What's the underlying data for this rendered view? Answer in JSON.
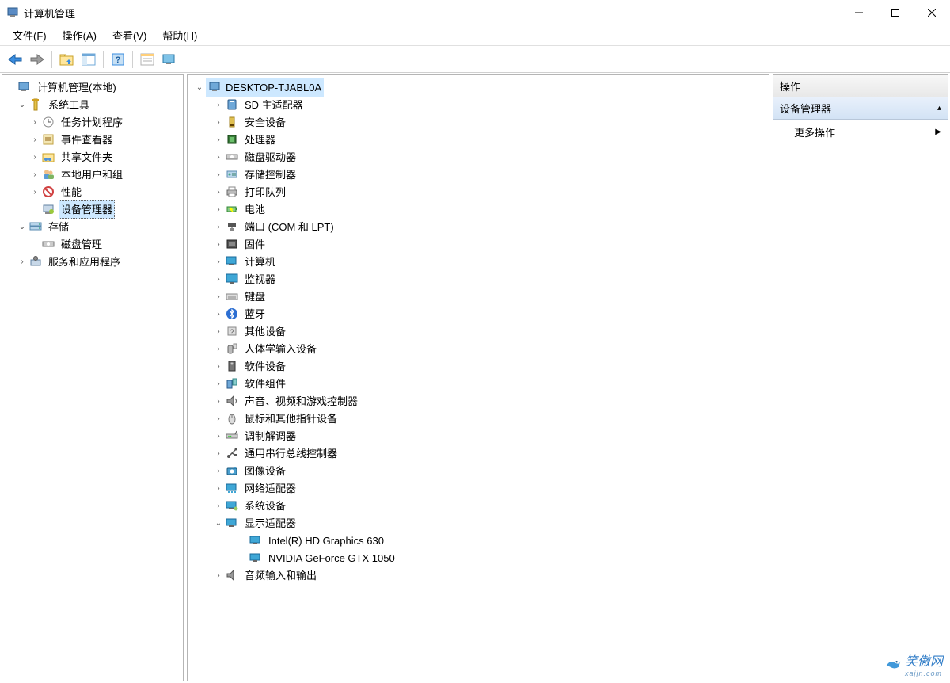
{
  "window": {
    "title": "计算机管理"
  },
  "menu": {
    "file": "文件(F)",
    "action": "操作(A)",
    "view": "查看(V)",
    "help": "帮助(H)"
  },
  "left_tree": {
    "root": "计算机管理(本地)",
    "sys_tools": "系统工具",
    "task_sched": "任务计划程序",
    "event_viewer": "事件查看器",
    "shared_folders": "共享文件夹",
    "local_users": "本地用户和组",
    "performance": "性能",
    "device_mgr": "设备管理器",
    "storage": "存储",
    "disk_mgmt": "磁盘管理",
    "services_apps": "服务和应用程序"
  },
  "device_tree": {
    "computer_name": "DESKTOP-TJABL0A",
    "categories": [
      {
        "label": "SD 主适配器",
        "icon": "sd"
      },
      {
        "label": "安全设备",
        "icon": "security"
      },
      {
        "label": "处理器",
        "icon": "cpu"
      },
      {
        "label": "磁盘驱动器",
        "icon": "disk"
      },
      {
        "label": "存储控制器",
        "icon": "storage-ctl"
      },
      {
        "label": "打印队列",
        "icon": "printer"
      },
      {
        "label": "电池",
        "icon": "battery"
      },
      {
        "label": "端口 (COM 和 LPT)",
        "icon": "port"
      },
      {
        "label": "固件",
        "icon": "firmware"
      },
      {
        "label": "计算机",
        "icon": "computer-cat"
      },
      {
        "label": "监视器",
        "icon": "monitor"
      },
      {
        "label": "键盘",
        "icon": "keyboard"
      },
      {
        "label": "蓝牙",
        "icon": "bluetooth"
      },
      {
        "label": "其他设备",
        "icon": "other"
      },
      {
        "label": "人体学输入设备",
        "icon": "hid"
      },
      {
        "label": "软件设备",
        "icon": "software"
      },
      {
        "label": "软件组件",
        "icon": "software-comp"
      },
      {
        "label": "声音、视频和游戏控制器",
        "icon": "sound"
      },
      {
        "label": "鼠标和其他指针设备",
        "icon": "mouse"
      },
      {
        "label": "调制解调器",
        "icon": "modem"
      },
      {
        "label": "通用串行总线控制器",
        "icon": "usb"
      },
      {
        "label": "图像设备",
        "icon": "camera"
      },
      {
        "label": "网络适配器",
        "icon": "network"
      },
      {
        "label": "系统设备",
        "icon": "system"
      }
    ],
    "display_adapter": {
      "label": "显示适配器",
      "children": [
        "Intel(R) HD Graphics 630",
        "NVIDIA GeForce GTX 1050"
      ]
    },
    "audio_io": {
      "label": "音频输入和输出"
    }
  },
  "right_panel": {
    "header": "操作",
    "section": "设备管理器",
    "more_actions": "更多操作"
  },
  "watermark": {
    "text": "笑傲网",
    "sub": "xajjn.com"
  }
}
